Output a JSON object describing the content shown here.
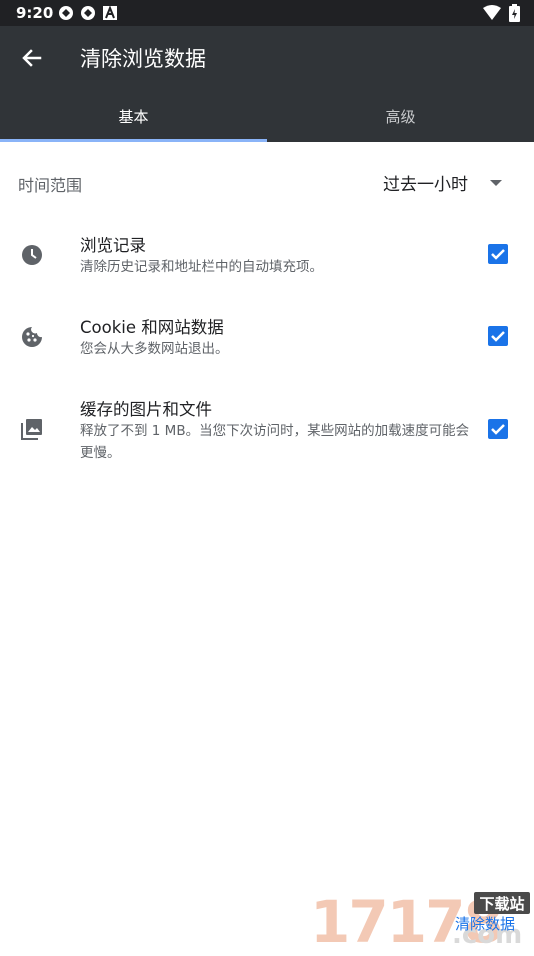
{
  "status_bar": {
    "time": "9:20",
    "icons": [
      "app-notification-icon",
      "app-notification-icon",
      "text-app-icon"
    ],
    "right_icons": [
      "wifi-icon",
      "battery-charging-icon"
    ]
  },
  "app_bar": {
    "title": "清除浏览数据",
    "back_icon": "arrow-back-icon"
  },
  "tabs": [
    {
      "label": "基本",
      "selected": true
    },
    {
      "label": "高级",
      "selected": false
    }
  ],
  "time_range": {
    "label": "时间范围",
    "value": "过去一小时"
  },
  "items": [
    {
      "title": "浏览记录",
      "description": "清除历史记录和地址栏中的自动填充项。",
      "icon": "clock-icon",
      "checked": true
    },
    {
      "title": "Cookie 和网站数据",
      "description": "您会从大多数网站退出。",
      "icon": "cookie-icon",
      "checked": true
    },
    {
      "title": "缓存的图片和文件",
      "description": "释放了不到 1 MB。当您下次访问时，某些网站的加载速度可能会更慢。",
      "icon": "image-icon",
      "checked": true
    }
  ],
  "watermark": {
    "numbers": "17178",
    "domain": ".com",
    "badge": "下载站",
    "link": "清除数据"
  },
  "colors": {
    "app_bar": "#303438",
    "status_bar": "#202124",
    "accent": "#1a73e8",
    "tab_indicator": "#8ab4f8"
  }
}
